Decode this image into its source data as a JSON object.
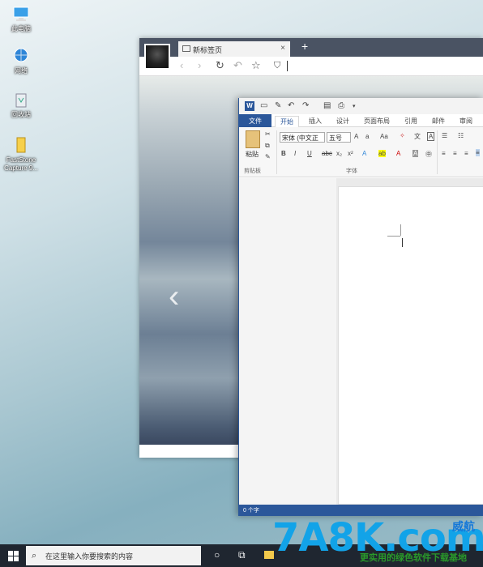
{
  "desktop": {
    "icons": [
      {
        "label": "此电脑",
        "icon": "computer-icon"
      },
      {
        "label": "网络",
        "icon": "network-icon"
      },
      {
        "label": "回收站",
        "icon": "recycle-bin-icon"
      },
      {
        "label": "FastStone Capture 9...",
        "icon": "faststone-capture-icon"
      }
    ]
  },
  "browser": {
    "tab_title": "新标签页",
    "tab_close": "×",
    "new_tab": "+",
    "nav": {
      "back": "‹",
      "forward": "›",
      "reload": "↻",
      "undo": "↶",
      "star": "☆",
      "shield": "⛉"
    }
  },
  "word": {
    "ribbon_tabs": [
      "文件",
      "开始",
      "插入",
      "设计",
      "页面布局",
      "引用",
      "邮件",
      "审阅"
    ],
    "active_tab": "开始",
    "clipboard": {
      "paste_label": "粘贴",
      "group_label": "剪贴板"
    },
    "font": {
      "font_name": "宋体 (中文正",
      "font_size": "五号",
      "group_label": "字体"
    },
    "status": "0 个字"
  },
  "taskbar": {
    "search_placeholder": "在这里输入你要搜索的内容"
  },
  "watermark": {
    "brand": "7A8K.com",
    "tag": "威航",
    "slogan": "更实用的绿色软件下载基地"
  },
  "colors": {
    "word_blue": "#2b579a",
    "taskbar": "#1f2630",
    "browser_titlebar": "#4a5363"
  }
}
